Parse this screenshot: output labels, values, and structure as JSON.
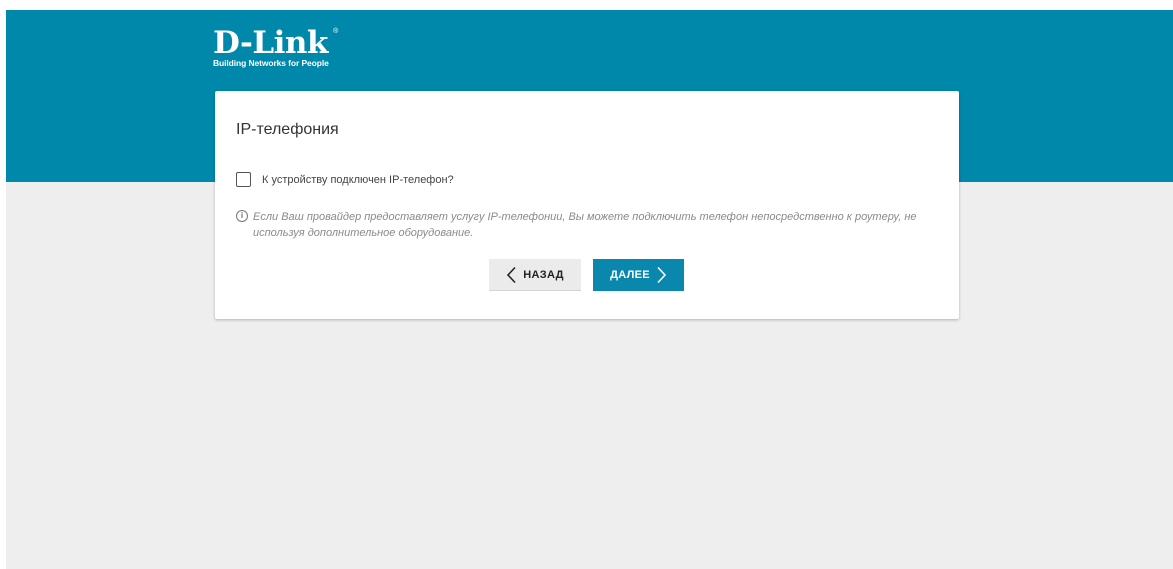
{
  "brand": {
    "logo_text": "D-Link",
    "registered": "®",
    "tagline": "Building Networks for People"
  },
  "colors": {
    "header": "#0088ab",
    "background": "#eeeeee",
    "primary_button": "#0a87ad",
    "secondary_button": "#ebebeb"
  },
  "wizard": {
    "title": "IP-телефония",
    "checkbox": {
      "label": "К устройству подключен IP-телефон?",
      "checked": false
    },
    "info_icon": "info-circle-icon",
    "info_text": "Если Ваш провайдер предоставляет услугу IP-телефонии, Вы можете подключить телефон непосредственно к роутеру, не используя дополнительное оборудование.",
    "buttons": {
      "back": {
        "label": "НАЗАД",
        "icon": "chevron-left-icon"
      },
      "next": {
        "label": "ДАЛЕЕ",
        "icon": "chevron-right-icon"
      }
    }
  }
}
